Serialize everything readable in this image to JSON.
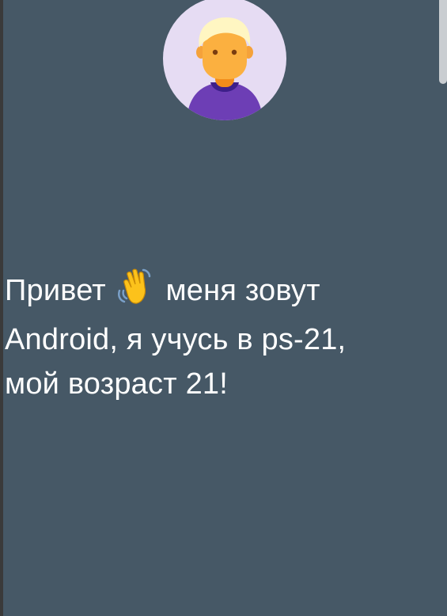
{
  "profile": {
    "avatar_icon": "user-avatar-icon",
    "greeting_before_emoji": "Привет",
    "emoji_icon": "waving-hand-icon",
    "greeting_line1_after_emoji": "меня зовут",
    "greeting_line2": "Android, я учусь в ps-21,",
    "greeting_line3": "мой возраст 21!"
  },
  "colors": {
    "background": "#465866",
    "text": "#ffffff",
    "avatar_bg": "#e6dcf3",
    "hair": "#fff6c2",
    "skin": "#fbb040",
    "shirt": "#6d3eb5"
  }
}
